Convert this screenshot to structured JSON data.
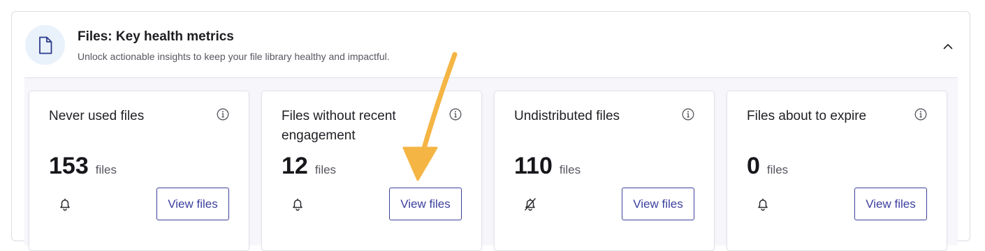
{
  "header": {
    "icon": "document-icon",
    "title": "Files: Key health metrics",
    "subtitle": "Unlock actionable insights to keep your file library healthy and impactful.",
    "collapse_icon": "chevron-up-icon"
  },
  "cards": [
    {
      "title": "Never used files",
      "value": "153",
      "unit": "files",
      "bell": "bell-icon",
      "button": "View files"
    },
    {
      "title": "Files without recent engagement",
      "value": "12",
      "unit": "files",
      "bell": "bell-icon",
      "button": "View files"
    },
    {
      "title": "Undistributed files",
      "value": "110",
      "unit": "files",
      "bell": "bell-off-icon",
      "button": "View files"
    },
    {
      "title": "Files about to expire",
      "value": "0",
      "unit": "files",
      "bell": "bell-icon",
      "button": "View files"
    }
  ],
  "colors": {
    "accent": "#3b3f9e",
    "icon_bg": "#e9f1fb",
    "annotation_arrow": "#f5b544"
  }
}
